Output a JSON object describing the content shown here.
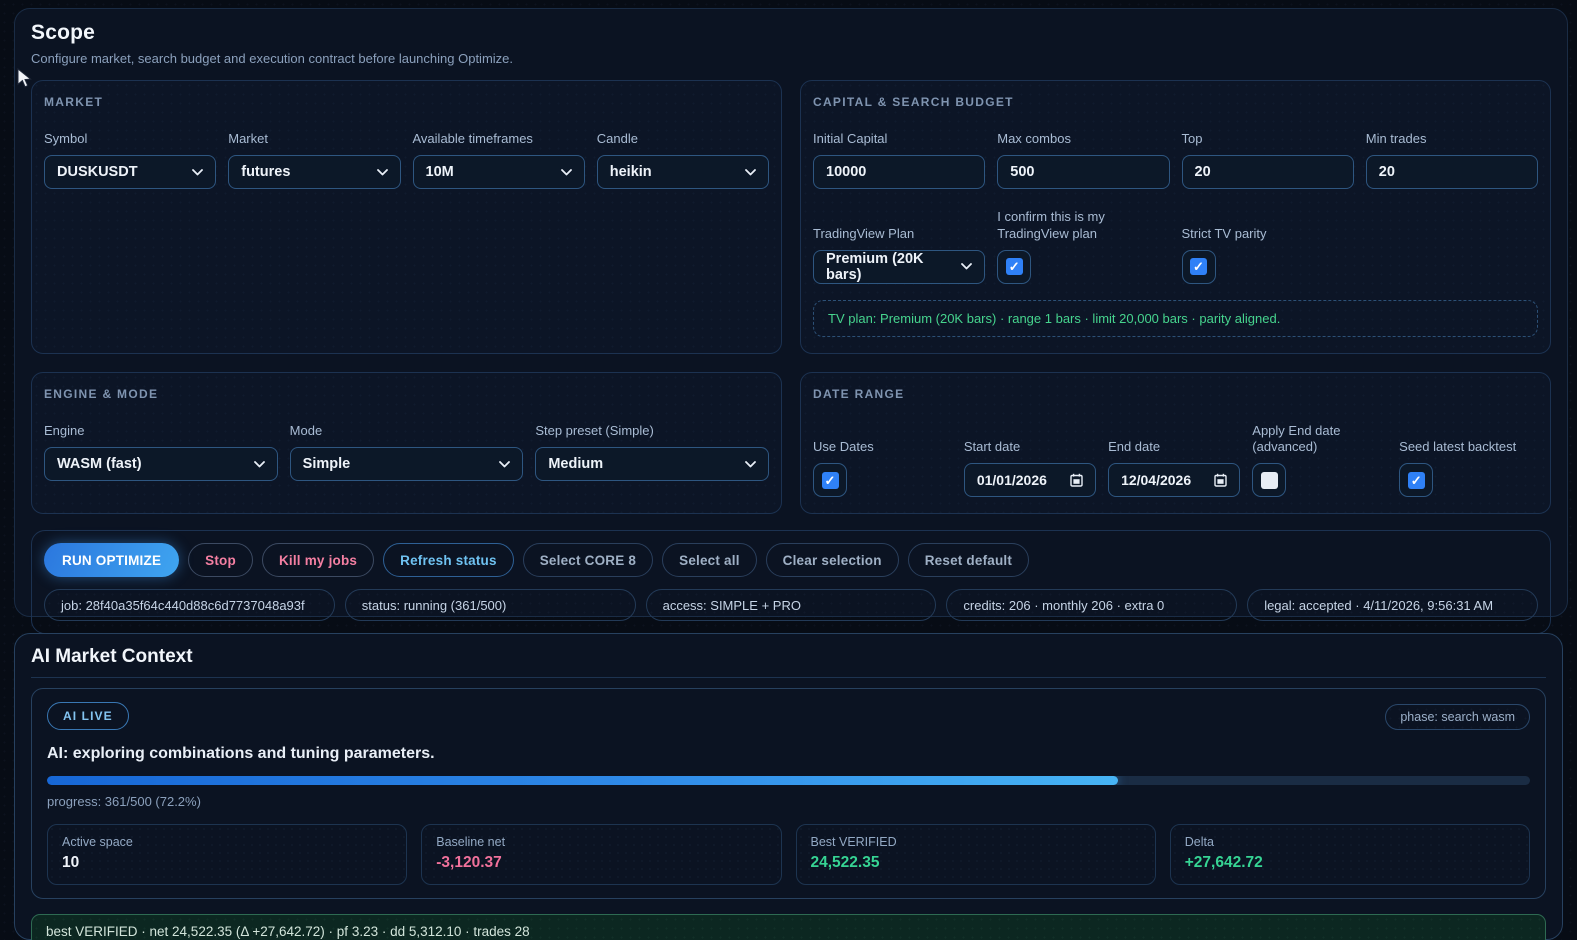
{
  "page": {
    "title": "Scope",
    "subtitle": "Configure market, search budget and execution contract before launching Optimize."
  },
  "market": {
    "heading": "MARKET",
    "fields": [
      {
        "label": "Symbol",
        "value": "DUSKUSDT"
      },
      {
        "label": "Market",
        "value": "futures"
      },
      {
        "label": "Available timeframes",
        "value": "10M"
      },
      {
        "label": "Candle",
        "value": "heikin"
      }
    ]
  },
  "capital": {
    "heading": "CAPITAL & SEARCH BUDGET",
    "fields": [
      {
        "label": "Initial Capital",
        "value": "10000"
      },
      {
        "label": "Max combos",
        "value": "500"
      },
      {
        "label": "Top",
        "value": "20"
      },
      {
        "label": "Min trades",
        "value": "20"
      }
    ],
    "tv_plan": {
      "label": "TradingView Plan",
      "value": "Premium (20K bars)"
    },
    "confirm": {
      "label": "I confirm this is my TradingView plan",
      "checked": true
    },
    "strict": {
      "label": "Strict TV parity",
      "checked": true
    },
    "note": "TV plan: Premium (20K bars) · range 1 bars · limit 20,000 bars · parity aligned."
  },
  "engine": {
    "heading": "ENGINE & MODE",
    "fields": [
      {
        "label": "Engine",
        "value": "WASM (fast)"
      },
      {
        "label": "Mode",
        "value": "Simple"
      },
      {
        "label": "Step preset (Simple)",
        "value": "Medium"
      }
    ]
  },
  "date_range": {
    "heading": "DATE RANGE",
    "use_dates": {
      "label": "Use Dates",
      "checked": true
    },
    "start": {
      "label": "Start date",
      "value": "01/01/2026"
    },
    "end": {
      "label": "End date",
      "value": "12/04/2026"
    },
    "apply_end": {
      "label": "Apply End date (advanced)",
      "checked": false
    },
    "seed": {
      "label": "Seed latest backtest",
      "checked": true
    }
  },
  "toolbar": {
    "buttons": {
      "run": "RUN OPTIMIZE",
      "stop": "Stop",
      "kill": "Kill my jobs",
      "refresh": "Refresh status",
      "core8": "Select CORE 8",
      "select_all": "Select all",
      "clear": "Clear selection",
      "reset": "Reset default"
    },
    "chips": [
      {
        "text": "job: 28f40a35f64c440d88c6d7737048a93f"
      },
      {
        "text": "status: running (361/500)"
      },
      {
        "text": "access: SIMPLE + PRO"
      },
      {
        "text": "credits: 206 · monthly 206 · extra 0"
      },
      {
        "text": "legal: accepted · 4/11/2026, 9:56:31 AM"
      }
    ]
  },
  "ai": {
    "heading": "AI Market Context",
    "live_badge": "AI LIVE",
    "phase_chip": "phase: search wasm",
    "status_text": "AI: exploring combinations and tuning parameters.",
    "progress_percent": 72.2,
    "progress_text": "progress: 361/500 (72.2%)",
    "stats": [
      {
        "label": "Active space",
        "value": "10",
        "tone": "neutral"
      },
      {
        "label": "Baseline net",
        "value": "-3,120.37",
        "tone": "negative"
      },
      {
        "label": "Best VERIFIED",
        "value": "24,522.35",
        "tone": "positive"
      },
      {
        "label": "Delta",
        "value": "+27,642.72",
        "tone": "positive"
      }
    ],
    "summary": "best VERIFIED · net 24,522.35 (Δ +27,642.72) · pf 3.23 · dd 5,312.10 · trades 28"
  },
  "colors": {
    "accent_blue": "#2f81f7",
    "progress_gradient": [
      "#1767d6",
      "#47b4f5"
    ],
    "positive_green": "#36d494",
    "negative_pink": "#f0719b",
    "note_green": "#46d48e",
    "page_bg": "#070c15",
    "card_bg": "#0b1322"
  }
}
